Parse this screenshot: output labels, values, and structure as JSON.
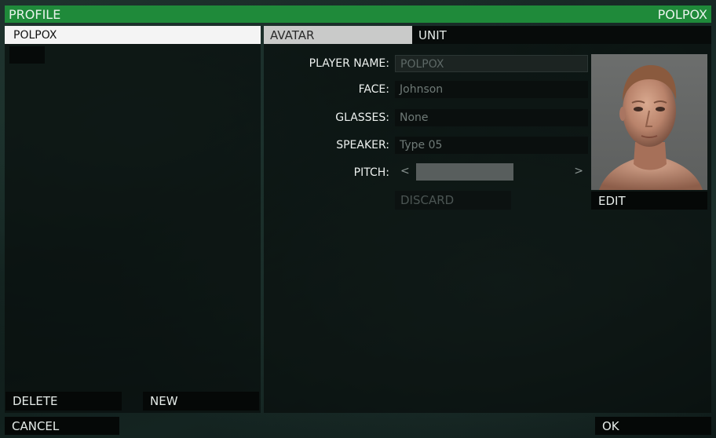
{
  "header": {
    "title": "PROFILE",
    "profile_name": "POLPOX"
  },
  "profiles": {
    "selected": "POLPOX"
  },
  "tabs": [
    {
      "label": "AVATAR"
    },
    {
      "label": "UNIT"
    }
  ],
  "form": {
    "player_name": {
      "label": "PLAYER NAME:",
      "value": "POLPOX"
    },
    "face": {
      "label": "FACE:",
      "value": "Johnson"
    },
    "glasses": {
      "label": "GLASSES:",
      "value": "None"
    },
    "speaker": {
      "label": "SPEAKER:",
      "value": "Type 05"
    },
    "pitch": {
      "label": "PITCH:",
      "left_arrow": "<",
      "right_arrow": ">"
    },
    "discard_label": "DISCARD"
  },
  "portrait": {
    "edit_label": "EDIT"
  },
  "left_buttons": {
    "delete_label": "DELETE",
    "new_label": "NEW"
  },
  "footer": {
    "cancel_label": "CANCEL",
    "ok_label": "OK"
  }
}
